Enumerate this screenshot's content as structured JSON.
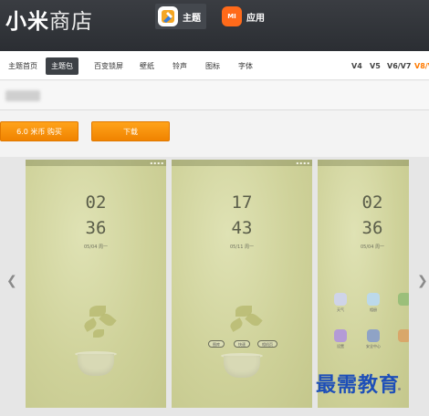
{
  "header": {
    "logo_main": "小米",
    "logo_light": "商店",
    "tabs": [
      {
        "label": "主题",
        "icon": "paintbrush-icon"
      },
      {
        "label": "应用",
        "icon": "mi-bag-icon",
        "icon_text": "MI"
      }
    ]
  },
  "nav": {
    "items": [
      "主题首页",
      "主题包",
      "百变锁屏",
      "壁纸",
      "铃声",
      "图标",
      "字体"
    ],
    "active": "主题包",
    "versions": [
      "V4",
      "V5",
      "V6/V7",
      "V8/V"
    ],
    "active_version": "V8/V"
  },
  "actions": {
    "buy_label": "6.0 米币 购买",
    "download_label": "下载",
    "accent": "#f39800"
  },
  "gallery": {
    "screens": [
      {
        "hour": "02",
        "minute": "36",
        "date": "05/04 周一"
      },
      {
        "hour": "17",
        "minute": "43",
        "date": "05/11 周一",
        "buttons": [
          "图库",
          "快速",
          "相机页"
        ]
      },
      {
        "hour": "02",
        "minute": "36",
        "date": "05/04 周一",
        "apps": [
          "天气",
          "相册",
          "",
          "设置",
          "安全中心",
          ""
        ]
      }
    ],
    "prev_icon": "chevron-left-icon",
    "next_icon": "chevron-right-icon"
  },
  "watermark": "最需教育"
}
